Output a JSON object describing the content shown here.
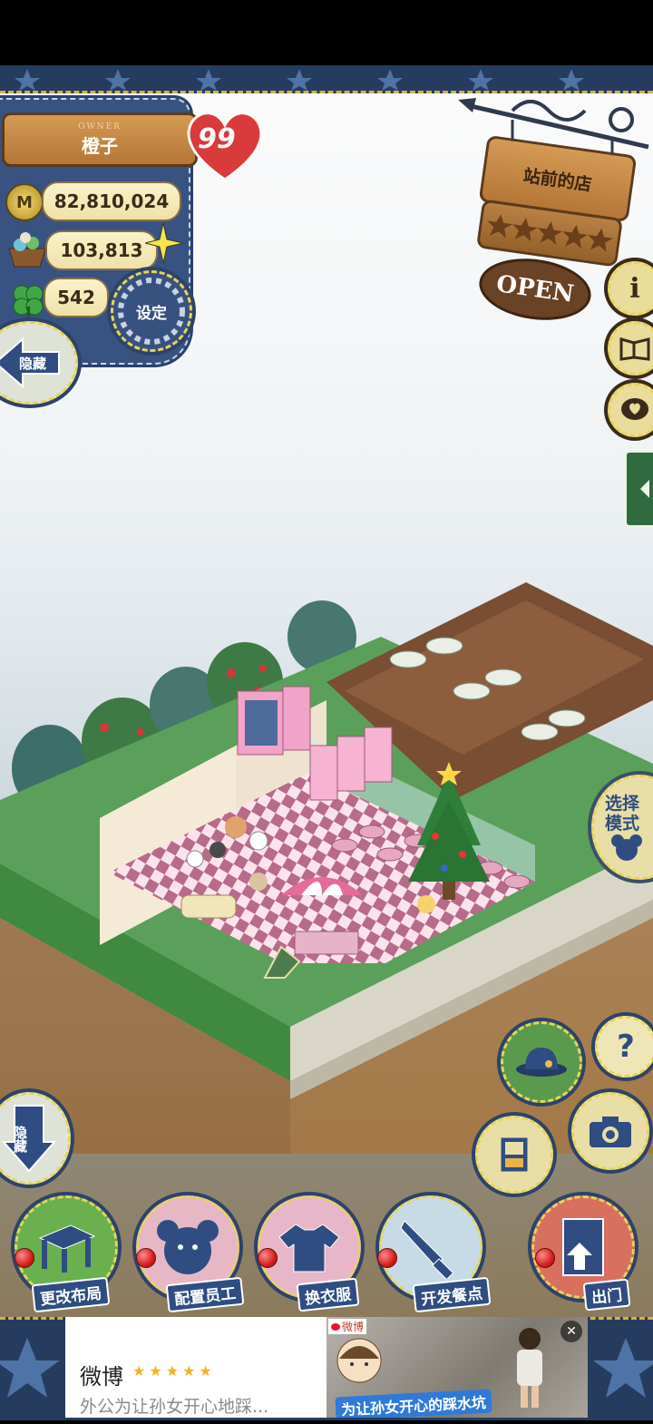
{
  "owner": {
    "tag": "OWNER",
    "name": "橙子",
    "level": "99"
  },
  "currencies": {
    "coins": "82,810,024",
    "materials": "103,813",
    "clovers": "542"
  },
  "left_buttons": {
    "settings": "设定",
    "hide_top": "隐藏",
    "hide_bottom": "隐藏"
  },
  "shop_sign": {
    "name": "站前的店",
    "status": "OPEN",
    "stars": 5
  },
  "right_buttons": {
    "select_mode": "选择模式",
    "help": "?"
  },
  "bottom_toolbar": [
    {
      "label": "更改布局",
      "icon": "table-icon"
    },
    {
      "label": "配置员工",
      "icon": "bear-icon"
    },
    {
      "label": "换衣服",
      "icon": "shirt-icon"
    },
    {
      "label": "开发餐点",
      "icon": "knife-icon"
    },
    {
      "label": "出门",
      "icon": "door-icon"
    }
  ],
  "ad": {
    "brand": "微博",
    "rating": 5,
    "text": "外公为让孙女开心地踩...",
    "source": "微博",
    "image_caption": "为让孙女开心的踩水坑"
  },
  "colors": {
    "denim": "#385382",
    "accent_red": "#d93a3a",
    "grass": "#5aa05a",
    "floor_pink": "#f3c6d6"
  }
}
